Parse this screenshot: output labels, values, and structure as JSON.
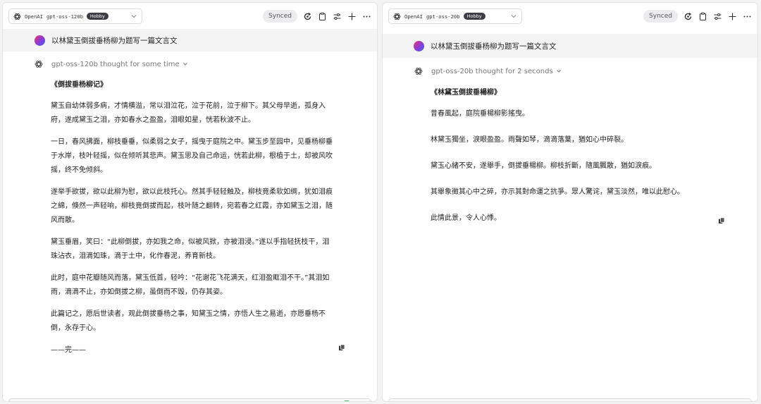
{
  "colors": {
    "accent": "#3f5ff5",
    "badge_bg": "#3c3c44",
    "panel_bg": "#ffffff",
    "user_row_bg": "#f4f4f5"
  },
  "left": {
    "provider": "OpenAI",
    "model": "gpt-oss-120b",
    "tier": "Hobby",
    "status": "Synced",
    "user_message": "以林黛玉倒拔垂杨柳为题写一篇文言文",
    "thought": "gpt-oss-120b thought for some time",
    "title": "《倒拔垂杨柳记》",
    "paragraphs": [
      "黛玉自幼体弱多病，才情横溢，常以泪泣花，泣于花前，泣于柳下。其父母早逝，孤身入府，遂成黛玉之泪，亦如春水之盈盈，泪眼如星，恍若秋波不止。",
      "一日，春风拂面，柳枝垂垂，似柔弱之女子，摇曳于庭院之中。黛玉步至园中，见垂杨柳垂于水岸，枝叶轻摇，似在倾听其悲声。黛玉思及自己命运，恍若此柳，根植于土，却被风吹摇，终不免倾斜。",
      "遂举手欲拔，欲以此柳为慰，欲以此枝托心。然其手轻轻触及，柳枝竟柔软如绸，犹如泪痕之綿，倏然一声轻响，柳枝竟倒拔而起，枝叶随之翻转，宛若春之红霞，亦如黛玉之泪，随风而散。",
      "黛玉垂眉，笑曰：“此柳倒拔，亦如我之命，似被风掀，亦被泪浸。”遂以手指轻抚枝干，泪珠沾衣，泪滴如珠，滴于土中，化作春泥，养育新枝。",
      "此时，庭中花瓣随风而落，黛玉低首，轻吟：“花谢花飞花满天，红泪盈眶泪不干。”其泪如雨，滴滴不止，亦如倒拔之柳，虽倒而不毁，仍存其姿。",
      "此篇记之，愿后世读者，观此倒拔垂杨之事，知黛玉之情，亦悟人生之易逝，亦愿垂杨不倒，永存于心。",
      "——完——"
    ]
  },
  "right": {
    "provider": "OpenAI",
    "model": "gpt-oss-20b",
    "tier": "Hobby",
    "status": "Synced",
    "user_message": "以林黛玉倒拔垂杨柳为题写一篇文言文",
    "thought": "gpt-oss-20b thought for 2 seconds",
    "title": "《林黛玉倒拔垂楊柳》",
    "paragraphs": [
      "昔春風起，庭院垂楊柳影搖曳。",
      "林黛玉獨坐，淚眼盈盈。雨聲如琴，滴滴落葉，猶如心中碎裂。",
      "黛玉心緒不安，遂舉手，倒拔垂楊柳。柳枝折斷，隨風飄散，猶如淚痕。",
      "其舉象徵其心中之碎，亦示其對命運之抗爭。眾人驚诧，黛玉淡然，唯以此慰心。",
      "此情此景，令人心悸。"
    ]
  }
}
